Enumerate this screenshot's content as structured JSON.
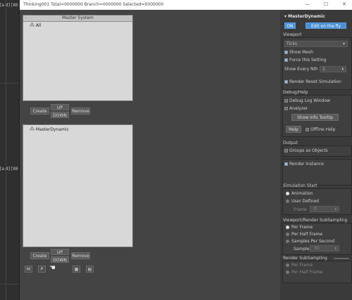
{
  "side_labels": [
    "[a d] [Wi",
    "[a d] [Wi"
  ],
  "titlebar": {
    "title": "Thinking001  Total=0000000  Branch=0000000  Selected=0000000",
    "minimize": "—",
    "maximize": "☐",
    "close": "✕"
  },
  "master_system": {
    "header": "Master System",
    "collapse": "-",
    "tree_item": "All"
  },
  "upper_buttons": {
    "create": "Create",
    "up": "UP",
    "down": "DOWN",
    "remove": "Remove"
  },
  "dynamic_tree": {
    "item": "MasterDynamic"
  },
  "lower_buttons": {
    "create": "Create",
    "up": "UP",
    "down": "DOWN",
    "remove": "Remove"
  },
  "tool_icons": {
    "m": "M",
    "p": "P"
  },
  "right_panel": {
    "title": "MasterDynamic",
    "on_button": "ON",
    "edit_button": "Edit on the fly",
    "viewport": {
      "header": "Viewport",
      "mode": "Ticks",
      "show_mesh": "Show Mesh",
      "force_setting": "Force this Setting",
      "show_every_nth": "Show Every Nth",
      "nth_value": "1",
      "render_reset": "Render Reset Simulation"
    },
    "debug": {
      "header": "Debug/Help",
      "debug_log": "Debug Log Window",
      "analyzer": "Analyzer",
      "show_tooltip": "Show Info Tooltip",
      "help": "Help",
      "offline_help": "Offline Help"
    },
    "output": {
      "header": "Output",
      "groups_as_objects": "Groups as Objects",
      "render_instance": "Render Instance"
    },
    "sim_start": {
      "header": "Simulation Start",
      "animation": "Animation",
      "user_defined": "User Defined",
      "frame_label": "Frame",
      "frame_value": "0"
    },
    "viewport_sub": {
      "header": "Viewport/Render SubSampling",
      "per_frame": "Per Frame",
      "per_half": "Per Half Frame",
      "per_second": "Samples Per Second",
      "samples_label": "Samples",
      "samples_value": "30"
    },
    "render_sub": {
      "header": "Render SubSampling",
      "per_frame": "Per Frame",
      "per_half": "Per Half Frame"
    }
  }
}
